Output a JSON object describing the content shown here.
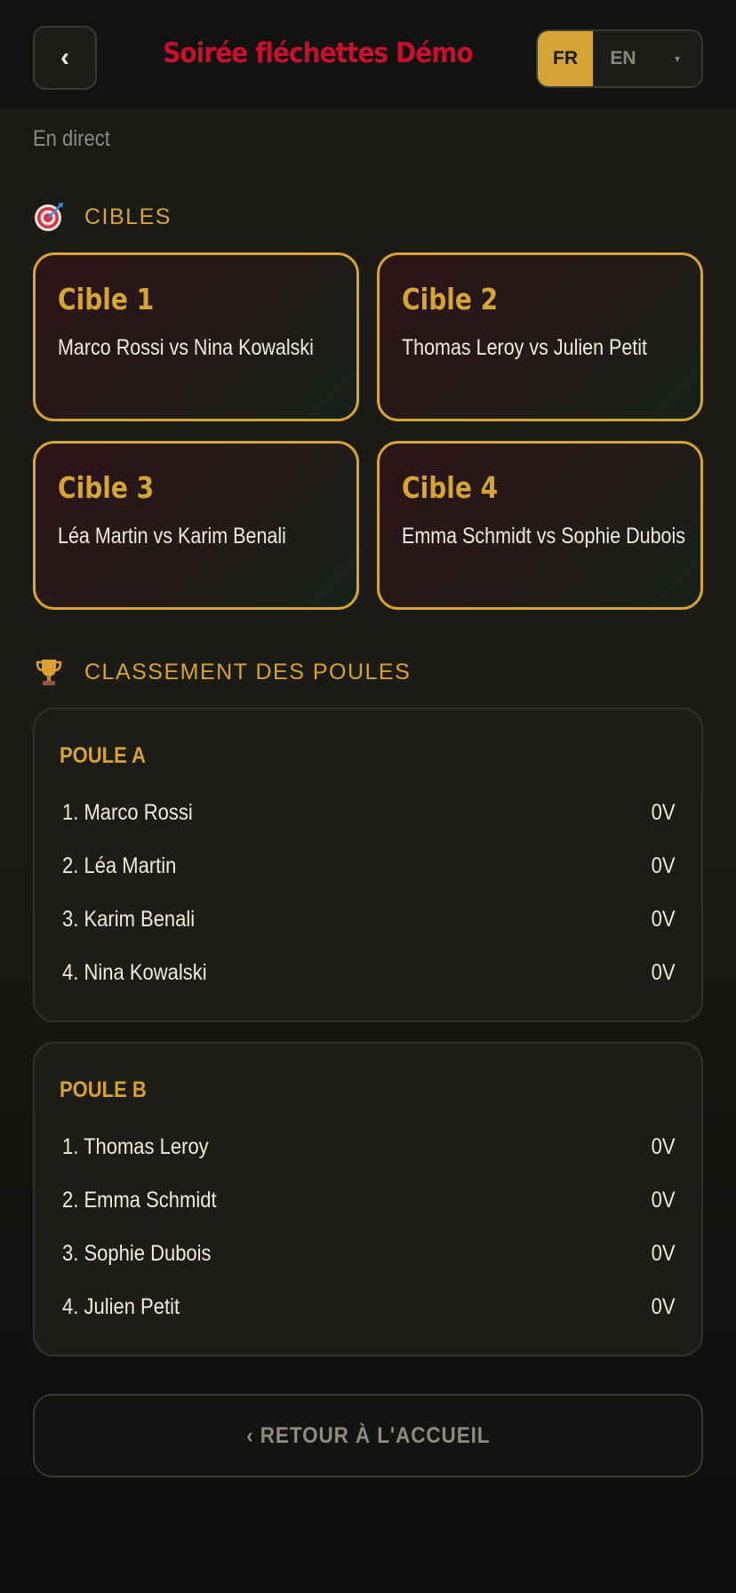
{
  "header": {
    "back_glyph": "‹",
    "title": "Soirée fléchettes Démo",
    "lang_selected": "FR",
    "lang_other": "EN",
    "lang_caret": "▾"
  },
  "status": "En direct",
  "targets_section": {
    "icon": "dartboard-icon",
    "title": "CIBLES",
    "cards": [
      {
        "name": "Cible 1",
        "match": "Marco Rossi vs Nina Kowalski"
      },
      {
        "name": "Cible 2",
        "match": "Thomas Leroy vs Julien Petit"
      },
      {
        "name": "Cible 3",
        "match": "Léa Martin vs Karim Benali"
      },
      {
        "name": "Cible 4",
        "match": "Emma Schmidt vs Sophie Dubois"
      }
    ]
  },
  "pools_section": {
    "icon": "trophy-icon",
    "title": "CLASSEMENT DES POULES",
    "pools": [
      {
        "title": "POULE A",
        "rows": [
          {
            "name": "1. Marco Rossi",
            "score": "0V"
          },
          {
            "name": "2. Léa Martin",
            "score": "0V"
          },
          {
            "name": "3. Karim Benali",
            "score": "0V"
          },
          {
            "name": "4. Nina Kowalski",
            "score": "0V"
          }
        ]
      },
      {
        "title": "POULE B",
        "rows": [
          {
            "name": "1. Thomas Leroy",
            "score": "0V"
          },
          {
            "name": "2. Emma Schmidt",
            "score": "0V"
          },
          {
            "name": "3. Sophie Dubois",
            "score": "0V"
          },
          {
            "name": "4. Julien Petit",
            "score": "0V"
          }
        ]
      }
    ]
  },
  "footer": {
    "home_label": "‹ RETOUR À L'ACCUEIL"
  },
  "colors": {
    "accent_gold": "#d4a437",
    "title_red": "#c8102e",
    "background": "#1a1a16"
  }
}
